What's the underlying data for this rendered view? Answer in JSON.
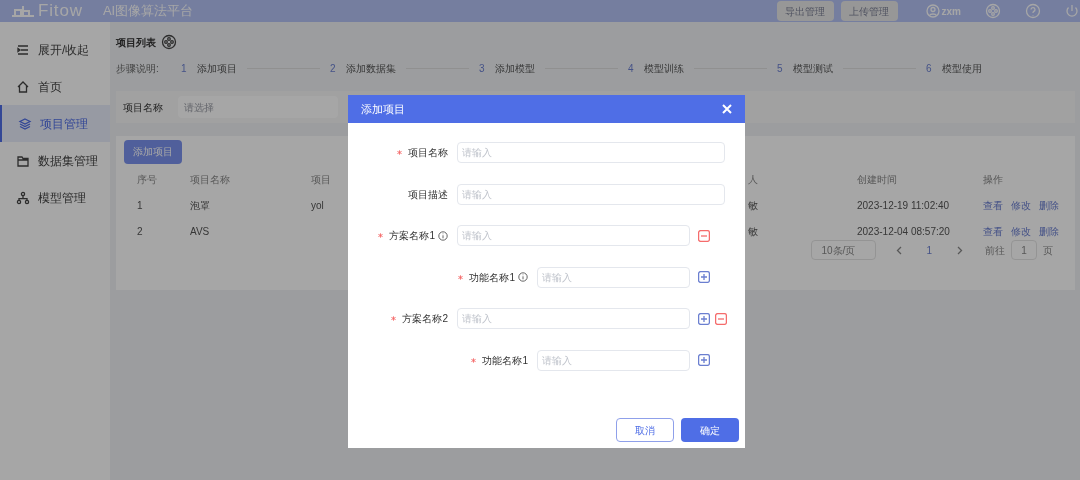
{
  "header": {
    "logo": "Fitow",
    "title": "AI图像算法平台",
    "buttons": [
      "导出管理",
      "上传管理"
    ],
    "user": "zxm"
  },
  "sidebar": {
    "items": [
      {
        "label": "展开/收起",
        "selected": false
      },
      {
        "label": "首页",
        "selected": false
      },
      {
        "label": "项目管理",
        "selected": true
      },
      {
        "label": "数据集管理",
        "selected": false
      },
      {
        "label": "模型管理",
        "selected": false
      }
    ]
  },
  "page_title": "项目列表",
  "steps": {
    "label": "步骤说明:",
    "items": [
      {
        "number": "1",
        "label": "添加项目"
      },
      {
        "number": "2",
        "label": "添加数据集"
      },
      {
        "number": "3",
        "label": "添加模型"
      },
      {
        "number": "4",
        "label": "模型训练"
      },
      {
        "number": "5",
        "label": "模型测试"
      },
      {
        "number": "6",
        "label": "模型使用"
      }
    ]
  },
  "filter": {
    "label": "项目名称",
    "placeholder": "请选择"
  },
  "add_button": "添加项目",
  "table": {
    "columns": [
      "序号",
      "项目名称",
      "项目",
      "人",
      "创建时间",
      "操作"
    ],
    "rows": [
      {
        "cells": [
          "1",
          "泡罩",
          "yol",
          "敏",
          "2023-12-19 11:02:40"
        ],
        "actions": [
          "查看",
          "修改",
          "删除"
        ]
      },
      {
        "cells": [
          "2",
          "AVS",
          "",
          "敏",
          "2023-12-04 08:57:20"
        ],
        "actions": [
          "查看",
          "修改",
          "删除"
        ]
      }
    ]
  },
  "pagination": {
    "page_size": "10条/页",
    "current": "1",
    "goto_label": "前往",
    "goto_value": "1",
    "unit": "页"
  },
  "dialog": {
    "title": "添加项目",
    "fields": [
      {
        "label": "项目名称",
        "required": true,
        "placeholder": "请输入"
      },
      {
        "label": "项目描述",
        "required": false,
        "placeholder": "请输入"
      }
    ],
    "schemes": [
      {
        "label": "方案名称1",
        "required": true,
        "info": true,
        "placeholder": "请输入",
        "add": false,
        "remove": true,
        "children": [
          {
            "label": "功能名称1",
            "required": true,
            "info": true,
            "placeholder": "请输入",
            "add": true
          }
        ]
      },
      {
        "label": "方案名称2",
        "required": true,
        "info": false,
        "placeholder": "请输入",
        "add": true,
        "remove": true,
        "children": [
          {
            "label": "功能名称1",
            "required": true,
            "info": false,
            "placeholder": "请输入",
            "add": true
          }
        ]
      }
    ],
    "cancel": "取消",
    "confirm": "确定"
  }
}
